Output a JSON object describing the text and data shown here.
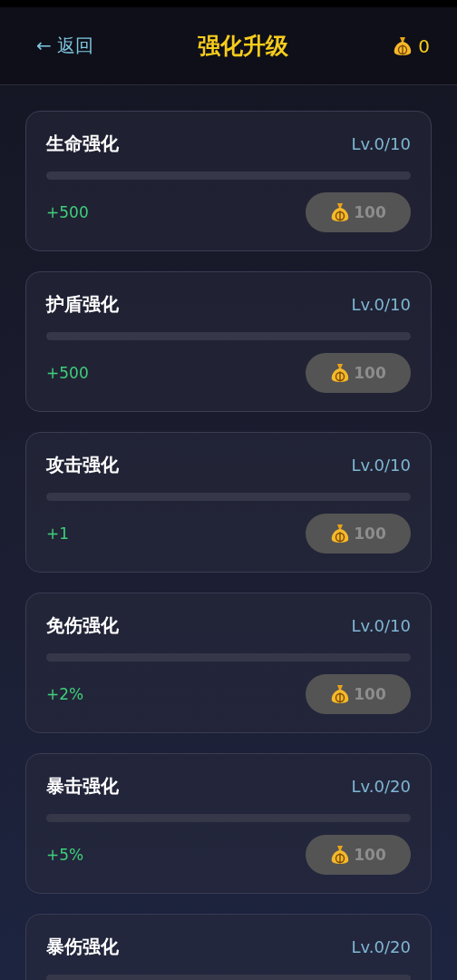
{
  "header": {
    "back": "← 返回",
    "title": "强化升级",
    "coins": "0"
  },
  "upgrades": [
    {
      "name": "生命强化",
      "level_text": "Lv.0/10",
      "level": 0,
      "effect": "+500",
      "cost": "100",
      "disabled": true
    },
    {
      "name": "护盾强化",
      "level_text": "Lv.0/10",
      "level": 0,
      "effect": "+500",
      "cost": "100",
      "disabled": true
    },
    {
      "name": "攻击强化",
      "level_text": "Lv.0/10",
      "level": 0,
      "effect": "+1",
      "cost": "100",
      "disabled": true
    },
    {
      "name": "免伤强化",
      "level_text": "Lv.0/10",
      "level": 0,
      "effect": "+2%",
      "cost": "100",
      "disabled": true
    },
    {
      "name": "暴击强化",
      "level_text": "Lv.0/20",
      "level": 0,
      "effect": "+5%",
      "cost": "100",
      "disabled": true
    },
    {
      "name": "暴伤强化",
      "level_text": "Lv.0/20",
      "level": 0
    }
  ]
}
